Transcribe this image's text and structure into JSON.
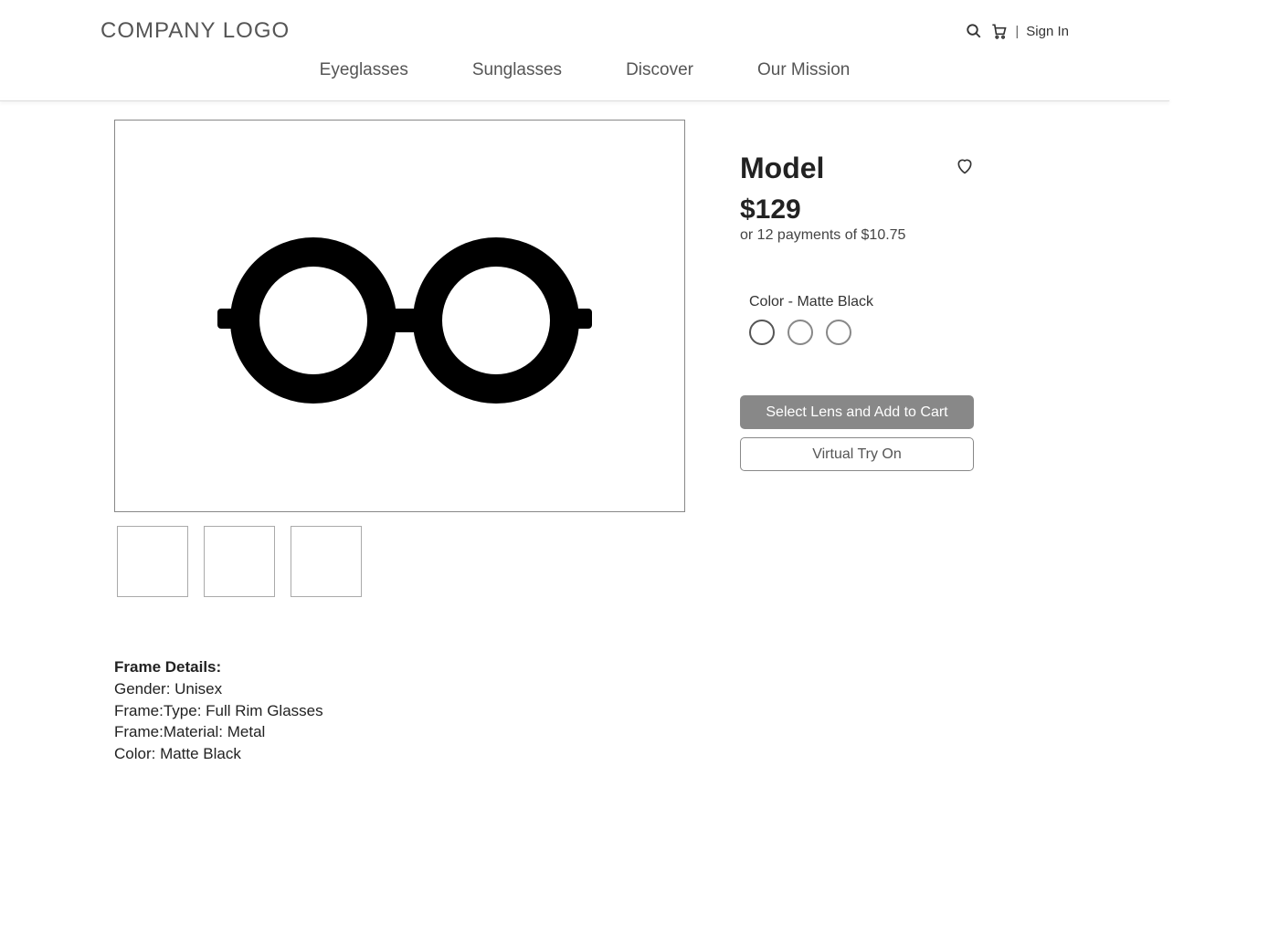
{
  "header": {
    "logo": "COMPANY LOGO",
    "sign_in": "Sign In",
    "divider": "|"
  },
  "nav": {
    "items": [
      "Eyeglasses",
      "Sunglasses",
      "Discover",
      "Our Mission"
    ]
  },
  "product": {
    "title": "Model",
    "price": "$129",
    "installment": "or 12 payments of $10.75",
    "color_label": "Color - Matte Black",
    "add_to_cart": "Select Lens and Add to Cart",
    "virtual_try": "Virtual Try On"
  },
  "details": {
    "heading": "Frame Details:",
    "gender": "Gender: Unisex",
    "frame_type": "Frame:Type: Full Rim Glasses",
    "frame_material": "Frame:Material: Metal",
    "color": "Color: Matte Black"
  }
}
